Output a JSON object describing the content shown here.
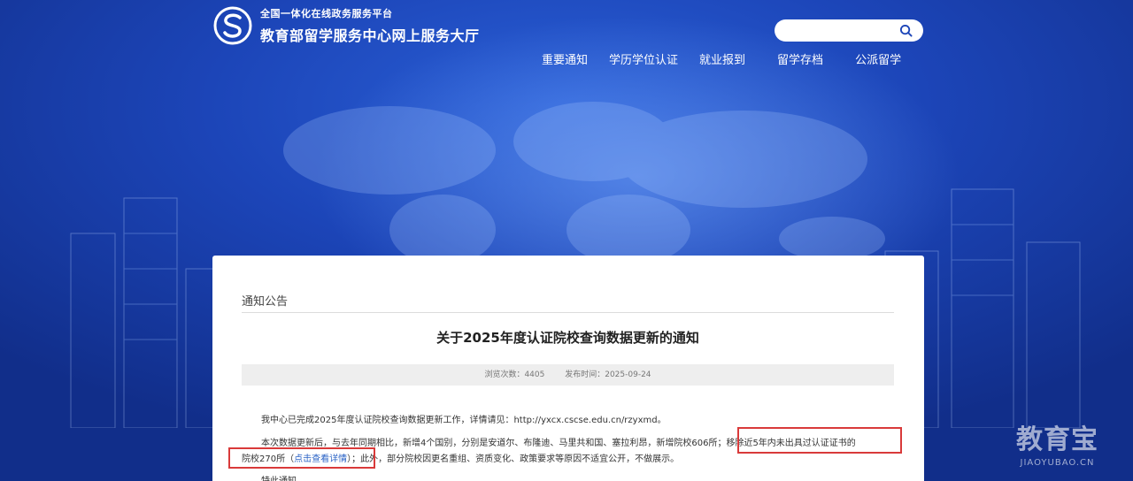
{
  "header": {
    "platform_label": "全国一体化在线政务服务平台",
    "site_name": "教育部留学服务中心网上服务大厅"
  },
  "search": {
    "placeholder": "",
    "icon": "search-icon"
  },
  "nav": {
    "items": [
      "重要通知",
      "学历学位认证",
      "就业报到",
      "留学存档",
      "公派留学"
    ]
  },
  "notice": {
    "section": "通知公告",
    "title": "关于2025年度认证院校查询数据更新的通知",
    "views_label": "浏览次数：4405",
    "date_label": "发布时间：2025-09-24",
    "p1": "我中心已完成2025年度认证院校查询数据更新工作，详情请见：http://yxcx.cscse.edu.cn/rzyxmd。",
    "p2": "本次数据更新后，与去年同期相比，新增4个国别，分别是安道尔、布隆迪、马里共和国、塞拉利昂，新增院校606所；移除近5年内未出具过认证证书的",
    "p3_a": "院校270所（",
    "p3_link": "点击查看详情",
    "p3_b": "）；此外，部分院校因更名重组、资质变化、政策要求等原因不适宜公开，不做展示。",
    "p4": "特此通知"
  },
  "watermark": {
    "cn": "教育宝",
    "en": "JIAOYUBAO.CN"
  },
  "colors": {
    "hero_blue": "#1c45b8",
    "highlight_red": "#d93a3a",
    "link_blue": "#2b63c6"
  }
}
